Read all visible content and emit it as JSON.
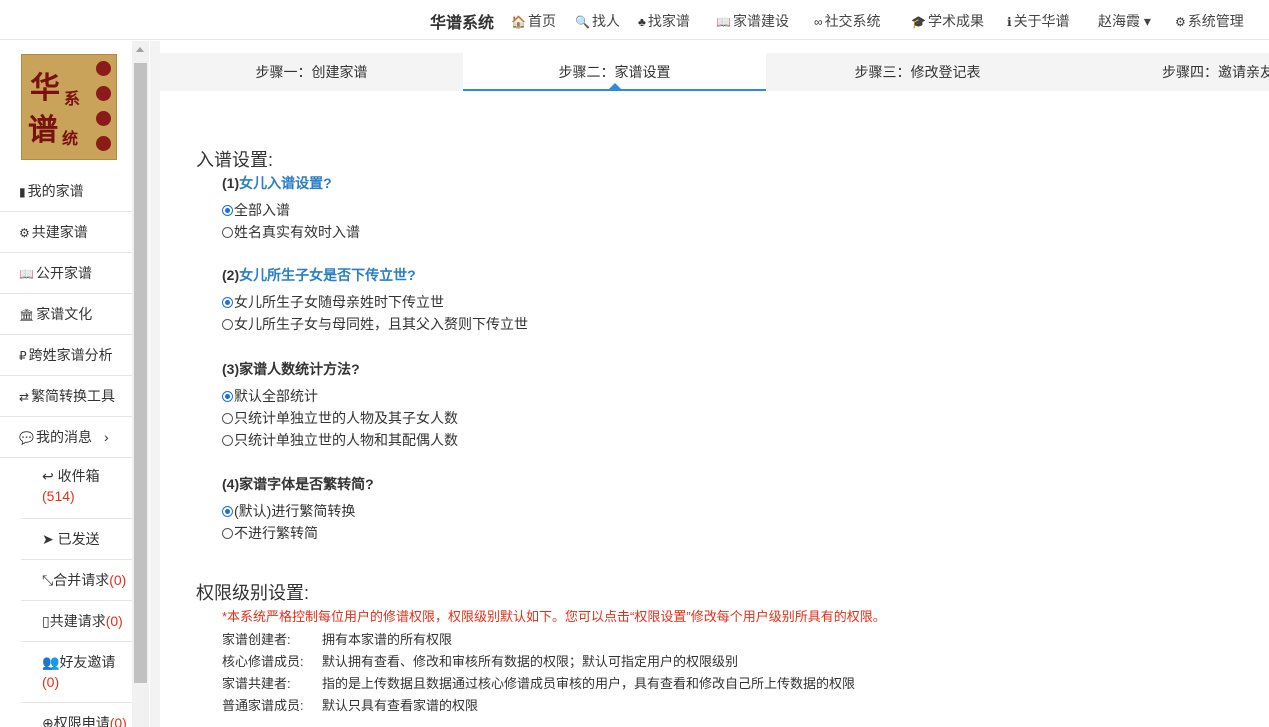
{
  "nav": {
    "brand": "华谱系统",
    "items": [
      {
        "icon": "home-icon",
        "glyph": "🏠",
        "label": "首页"
      },
      {
        "icon": "search-icon",
        "glyph": "🔍",
        "label": "找人"
      },
      {
        "icon": "tree-icon",
        "glyph": "♣",
        "label": "找家谱"
      },
      {
        "icon": "book-icon",
        "glyph": "📖",
        "label": "家谱建设"
      },
      {
        "icon": "link-icon",
        "glyph": "∞",
        "label": "社交系统"
      },
      {
        "icon": "graduation-cap-icon",
        "glyph": "🎓",
        "label": "学术成果"
      },
      {
        "icon": "info-icon",
        "glyph": "ℹ",
        "label": "关于华谱"
      },
      {
        "icon": "caret-down-icon",
        "glyph": "",
        "label": "赵海霞 ▾"
      },
      {
        "icon": "gears-icon",
        "glyph": "⚙",
        "label": "系统管理"
      }
    ]
  },
  "sidebar": {
    "logo_chars": [
      "华",
      "系",
      "谱",
      "统"
    ],
    "items": [
      {
        "glyph": "▮",
        "label": "我的家谱"
      },
      {
        "glyph": "⚙",
        "label": "共建家谱"
      },
      {
        "glyph": "📖",
        "label": "公开家谱"
      },
      {
        "glyph": "🏛",
        "label": "家谱文化"
      },
      {
        "glyph": "₽",
        "label": "跨姓家谱分析"
      },
      {
        "glyph": "⇄",
        "label": "繁简转换工具"
      },
      {
        "glyph": "💬",
        "label": "我的消息",
        "chevron": "›"
      }
    ],
    "sub_items": [
      {
        "glyph": "↩",
        "label": "收件箱",
        "count": "(514)"
      },
      {
        "glyph": "➤",
        "label": "已发送",
        "count": ""
      },
      {
        "glyph": "⤡",
        "label": "合并请求",
        "count": "(0)"
      },
      {
        "glyph": "▯",
        "label": "共建请求",
        "count": "(0)"
      },
      {
        "glyph": "👥",
        "label": "好友邀请",
        "count": "(0)"
      },
      {
        "glyph": "⊕",
        "label": "权限申请",
        "count": "(0)"
      }
    ]
  },
  "tabs": [
    {
      "label": "步骤一：创建家谱",
      "active": false
    },
    {
      "label": "步骤二：家谱设置",
      "active": true
    },
    {
      "label": "步骤三：修改登记表",
      "active": false
    },
    {
      "label": "步骤四：邀请亲友",
      "active": false
    }
  ],
  "entry_settings": {
    "title": "入谱设置:",
    "questions": [
      {
        "prefix": "(1)",
        "text": "女儿入谱设置?",
        "highlight": true,
        "options": [
          {
            "label": "全部入谱",
            "checked": true
          },
          {
            "label": "姓名真实有效时入谱",
            "checked": false
          }
        ]
      },
      {
        "prefix": "(2)",
        "text": "女儿所生子女是否下传立世?",
        "highlight": true,
        "options": [
          {
            "label": "女儿所生子女随母亲姓时下传立世",
            "checked": true
          },
          {
            "label": "女儿所生子女与母同姓，且其父入赘则下传立世",
            "checked": false
          }
        ]
      },
      {
        "prefix": "(3)",
        "text": "家谱人数统计方法?",
        "highlight": false,
        "options": [
          {
            "label": "默认全部统计",
            "checked": true
          },
          {
            "label": "只统计单独立世的人物及其子女人数",
            "checked": false
          },
          {
            "label": "只统计单独立世的人物和其配偶人数",
            "checked": false
          }
        ]
      },
      {
        "prefix": "(4)",
        "text": "家谱字体是否繁转简?",
        "highlight": false,
        "options": [
          {
            "label": "(默认)进行繁简转换",
            "checked": true
          },
          {
            "label": "不进行繁转简",
            "checked": false
          }
        ]
      }
    ]
  },
  "permission_settings": {
    "title": "权限级别设置:",
    "note": "*本系统严格控制每位用户的修谱权限，权限级别默认如下。您可以点击“权限设置”修改每个用户级别所具有的权限。",
    "roles": [
      {
        "role": "家谱创建者:",
        "desc": "拥有本家谱的所有权限"
      },
      {
        "role": "核心修谱成员:",
        "desc": "默认拥有查看、修改和审核所有数据的权限；默认可指定用户的权限级别"
      },
      {
        "role": "家谱共建者:",
        "desc": "指的是上传数据且数据通过核心修谱成员审核的用户，具有查看和修改自己所上传数据的权限"
      },
      {
        "role": "普通家谱成员:",
        "desc": "默认只具有查看家谱的权限"
      }
    ]
  },
  "colors": {
    "accent": "#2d8bd8",
    "highlight_text": "#2a7fc4",
    "warning": "#e0311a"
  }
}
